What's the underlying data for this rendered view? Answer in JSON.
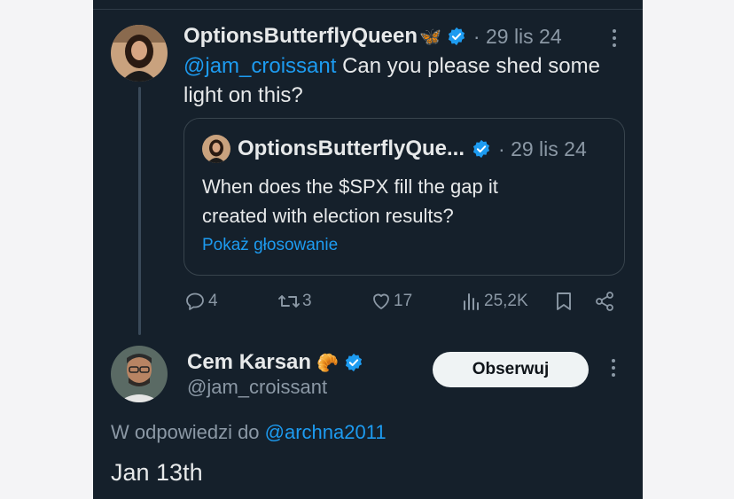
{
  "tweet": {
    "author_name": "OptionsButterflyQueen",
    "author_emoji": "🦋",
    "date": "· 29 lis 24",
    "mention": "@jam_croissant",
    "text_line1": " Can you please shed some",
    "text_line2": "light on this?"
  },
  "quote": {
    "author_name": "OptionsButterflyQue...",
    "date": "· 29 lis 24",
    "text_line1": "When does the $SPX fill the gap it",
    "text_line2": "created with election results?",
    "poll_link": "Pokaż głosowanie"
  },
  "actions": {
    "replies": "4",
    "retweets": "3",
    "likes": "17",
    "views": "25,2K"
  },
  "reply_author": {
    "name": "Cem Karsan",
    "emoji": "🥐",
    "handle": "@jam_croissant",
    "follow_label": "Obserwuj"
  },
  "reply": {
    "in_reply_prefix": "W odpowiedzi do ",
    "in_reply_handle": "@archna2011",
    "text": "Jan 13th"
  },
  "colors": {
    "background": "#15202b",
    "link": "#1d9bf0",
    "verified": "#1d9bf0",
    "muted": "#8b98a5"
  }
}
